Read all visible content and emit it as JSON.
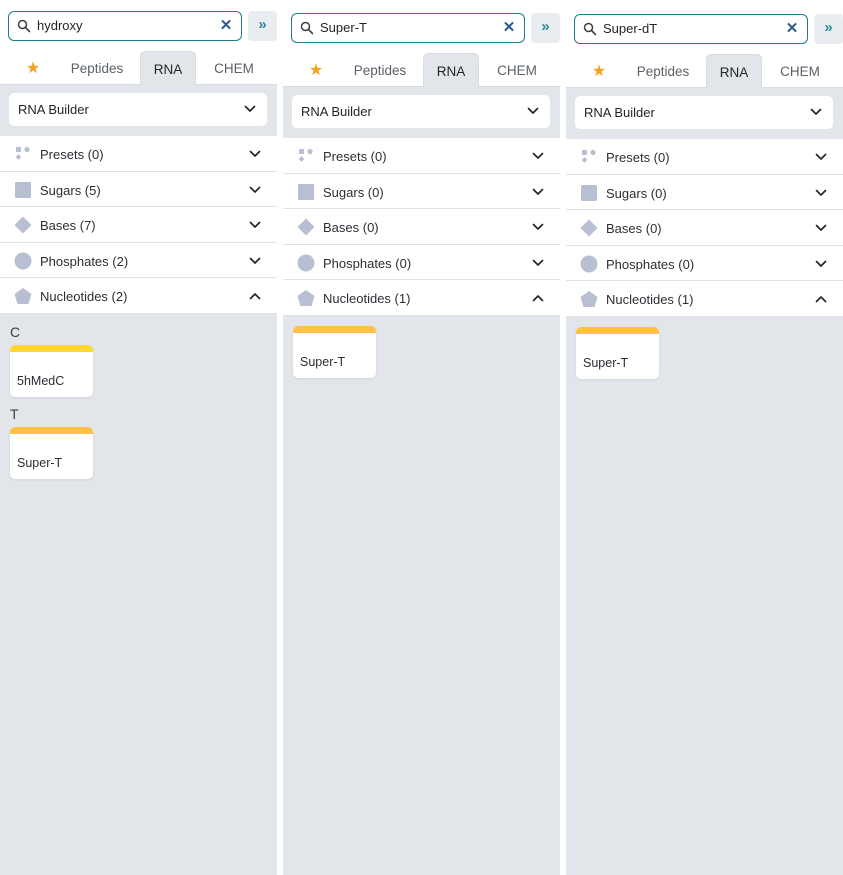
{
  "colors": {
    "accent": "#1d7e8a",
    "panel_bg": "#e2e5ea",
    "icon": "#b9bfd3",
    "star": "#f2a31b",
    "bar_yellow": "#ffd732",
    "bar_orange": "#ffc145"
  },
  "panels": [
    {
      "search": {
        "value": "hydroxy",
        "clear_icon": "close-icon"
      },
      "collapse_label": "»",
      "tabs": {
        "favorites": "★",
        "peptides": "Peptides",
        "rna": "RNA",
        "chem": "CHEM",
        "active": "rna"
      },
      "builder": {
        "label": "RNA Builder"
      },
      "sections": [
        {
          "label": "Presets (0)",
          "icon": "presets-icon",
          "expanded": false
        },
        {
          "label": "Sugars (5)",
          "icon": "sugar-icon",
          "expanded": false
        },
        {
          "label": "Bases (7)",
          "icon": "base-icon",
          "expanded": false
        },
        {
          "label": "Phosphates (2)",
          "icon": "phosphate-icon",
          "expanded": false
        },
        {
          "label": "Nucleotides (2)",
          "icon": "nucleotide-icon",
          "expanded": true
        }
      ],
      "groups": [
        {
          "letter": "C",
          "cards": [
            {
              "name": "5hMedC",
              "bar_color": "#ffd732"
            }
          ]
        },
        {
          "letter": "T",
          "cards": [
            {
              "name": "Super-T",
              "bar_color": "#ffc145"
            }
          ]
        }
      ]
    },
    {
      "search": {
        "value": "Super-T",
        "clear_icon": "close-icon"
      },
      "collapse_label": "»",
      "tabs": {
        "favorites": "★",
        "peptides": "Peptides",
        "rna": "RNA",
        "chem": "CHEM",
        "active": "rna"
      },
      "builder": {
        "label": "RNA Builder"
      },
      "sections": [
        {
          "label": "Presets (0)",
          "icon": "presets-icon",
          "expanded": false
        },
        {
          "label": "Sugars (0)",
          "icon": "sugar-icon",
          "expanded": false
        },
        {
          "label": "Bases (0)",
          "icon": "base-icon",
          "expanded": false
        },
        {
          "label": "Phosphates (0)",
          "icon": "phosphate-icon",
          "expanded": false
        },
        {
          "label": "Nucleotides (1)",
          "icon": "nucleotide-icon",
          "expanded": true
        }
      ],
      "groups": [
        {
          "letter": "",
          "cards": [
            {
              "name": "Super-T",
              "bar_color": "#ffc145"
            }
          ]
        }
      ]
    },
    {
      "search": {
        "value": "Super-dT",
        "clear_icon": "close-icon"
      },
      "collapse_label": "»",
      "tabs": {
        "favorites": "★",
        "peptides": "Peptides",
        "rna": "RNA",
        "chem": "CHEM",
        "active": "rna"
      },
      "builder": {
        "label": "RNA Builder"
      },
      "sections": [
        {
          "label": "Presets (0)",
          "icon": "presets-icon",
          "expanded": false
        },
        {
          "label": "Sugars (0)",
          "icon": "sugar-icon",
          "expanded": false
        },
        {
          "label": "Bases (0)",
          "icon": "base-icon",
          "expanded": false
        },
        {
          "label": "Phosphates (0)",
          "icon": "phosphate-icon",
          "expanded": false
        },
        {
          "label": "Nucleotides (1)",
          "icon": "nucleotide-icon",
          "expanded": true
        }
      ],
      "groups": [
        {
          "letter": "",
          "cards": [
            {
              "name": "Super-T",
              "bar_color": "#ffc145"
            }
          ]
        }
      ]
    }
  ]
}
